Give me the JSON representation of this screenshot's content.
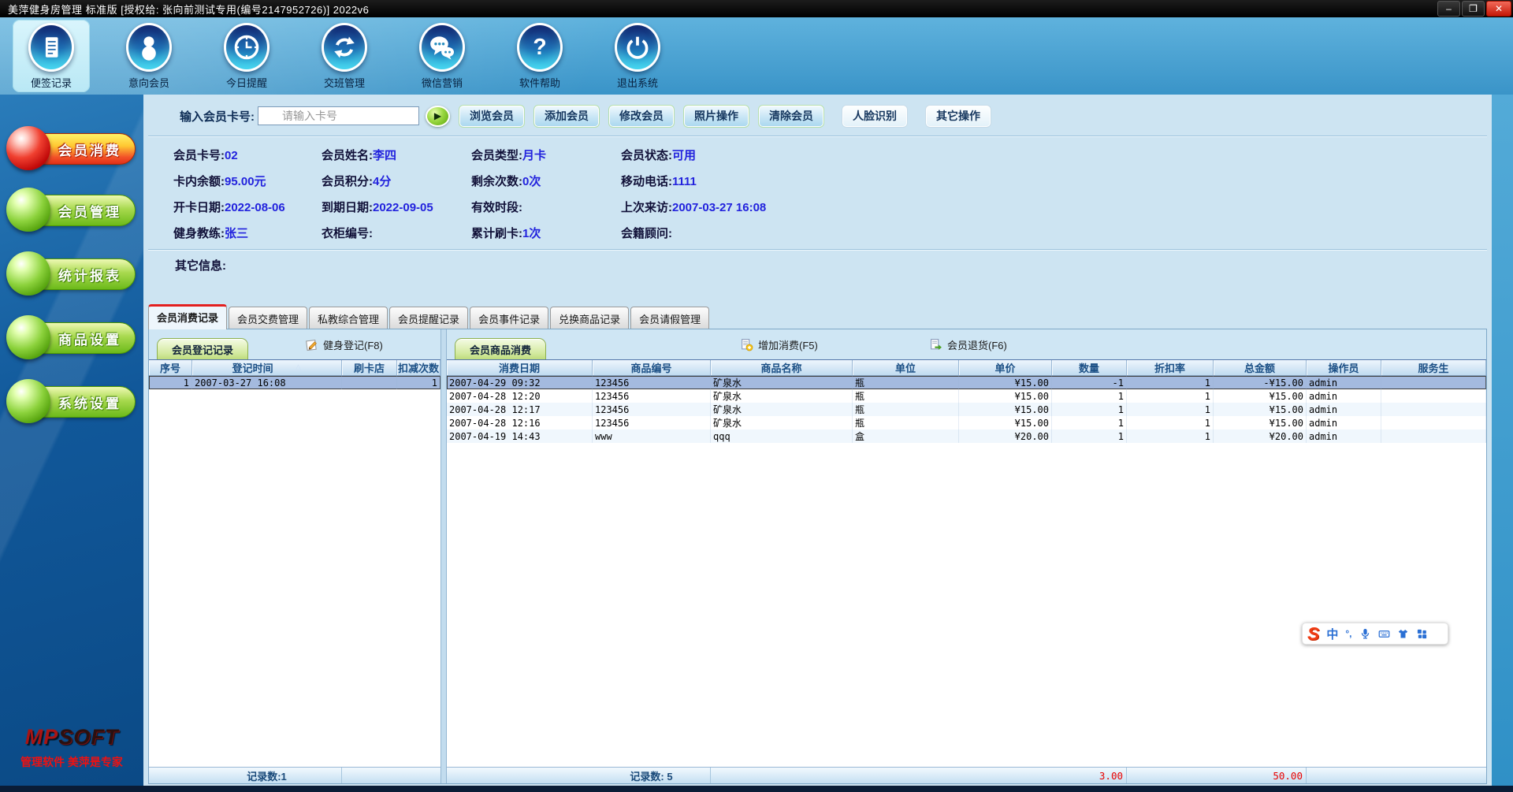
{
  "window": {
    "title": "美萍健身房管理 标准版 [授权给: 张向前测试专用(编号2147952726)]  2022v6",
    "controls": {
      "minimize": "–",
      "maximize": "❐",
      "close": "✕"
    }
  },
  "toolbar": {
    "items": [
      {
        "label": "便签记录"
      },
      {
        "label": "意向会员"
      },
      {
        "label": "今日提醒"
      },
      {
        "label": "交班管理"
      },
      {
        "label": "微信营销"
      },
      {
        "label": "软件帮助"
      },
      {
        "label": "退出系统"
      }
    ]
  },
  "sidebar": {
    "items": [
      {
        "label": "会员消费"
      },
      {
        "label": "会员管理"
      },
      {
        "label": "统计报表"
      },
      {
        "label": "商品设置"
      },
      {
        "label": "系统设置"
      }
    ],
    "logo_left": "MP",
    "logo_right": "SOFT",
    "slogan": "管理软件 美萍是专家"
  },
  "member_bar": {
    "label": "输入会员卡号:",
    "placeholder": "请输入卡号",
    "go": "▶",
    "buttons": [
      "浏览会员",
      "添加会员",
      "修改会员",
      "照片操作",
      "清除会员"
    ],
    "buttons2": [
      "人脸识别",
      "其它操作"
    ]
  },
  "member_info": {
    "fields": [
      {
        "label": "会员卡号:",
        "value": "02"
      },
      {
        "label": "会员姓名:",
        "value": "李四"
      },
      {
        "label": "会员类型:",
        "value": "月卡"
      },
      {
        "label": "会员状态:",
        "value": "可用"
      },
      {
        "label": "卡内余额:",
        "value": "95.00元"
      },
      {
        "label": "会员积分:",
        "value": "4分"
      },
      {
        "label": "剩余次数:",
        "value": "0次"
      },
      {
        "label": "移动电话:",
        "value": "1111"
      },
      {
        "label": "开卡日期:",
        "value": "2022-08-06"
      },
      {
        "label": "到期日期:",
        "value": "2022-09-05"
      },
      {
        "label": "有效时段:",
        "value": ""
      },
      {
        "label": "上次来访:",
        "value": "2007-03-27 16:08"
      },
      {
        "label": "健身教练:",
        "value": "张三"
      },
      {
        "label": "衣柜编号:",
        "value": ""
      },
      {
        "label": "累计刷卡:",
        "value": "1次"
      },
      {
        "label": "会籍顾问:",
        "value": ""
      }
    ]
  },
  "other_info_label": "其它信息:",
  "tabs": [
    "会员消费记录",
    "会员交费管理",
    "私教综合管理",
    "会员提醒记录",
    "会员事件记录",
    "兑换商品记录",
    "会员请假管理"
  ],
  "left_panel": {
    "tab": "会员登记记录",
    "action": "健身登记(F8)",
    "columns": [
      "序号",
      "登记时间",
      "刷卡店",
      "扣减次数"
    ],
    "rows": [
      [
        "1",
        "2007-03-27 16:08",
        "",
        "1"
      ]
    ],
    "status_count": "记录数:1"
  },
  "right_panel": {
    "tab": "会员商品消费",
    "action_add": "增加消费(F5)",
    "action_return": "会员退货(F6)",
    "columns": [
      "消费日期",
      "商品编号",
      "商品名称",
      "单位",
      "单价",
      "数量",
      "折扣率",
      "总金额",
      "操作员",
      "服务生"
    ],
    "rows": [
      [
        "2007-04-29 09:32",
        "123456",
        "矿泉水",
        "瓶",
        "¥15.00",
        "-1",
        "1",
        "-¥15.00",
        "admin",
        ""
      ],
      [
        "2007-04-28 12:20",
        "123456",
        "矿泉水",
        "瓶",
        "¥15.00",
        "1",
        "1",
        "¥15.00",
        "admin",
        ""
      ],
      [
        "2007-04-28 12:17",
        "123456",
        "矿泉水",
        "瓶",
        "¥15.00",
        "1",
        "1",
        "¥15.00",
        "admin",
        ""
      ],
      [
        "2007-04-28 12:16",
        "123456",
        "矿泉水",
        "瓶",
        "¥15.00",
        "1",
        "1",
        "¥15.00",
        "admin",
        ""
      ],
      [
        "2007-04-19 14:43",
        "www",
        "qqq",
        "盒",
        "¥20.00",
        "1",
        "1",
        "¥20.00",
        "admin",
        ""
      ]
    ],
    "status_count": "记录数: 5",
    "qty_total": "3.00",
    "amount_total": "50.00"
  },
  "ime": {
    "logo": "S",
    "mode": "中",
    "punct": "°,"
  },
  "colors": {
    "accent_blue": "#2f90c6",
    "value_blue": "#2222dd",
    "status_red": "#e80000",
    "selected_row": "#a4badf",
    "active_tab_stripe": "#e31f1f"
  }
}
